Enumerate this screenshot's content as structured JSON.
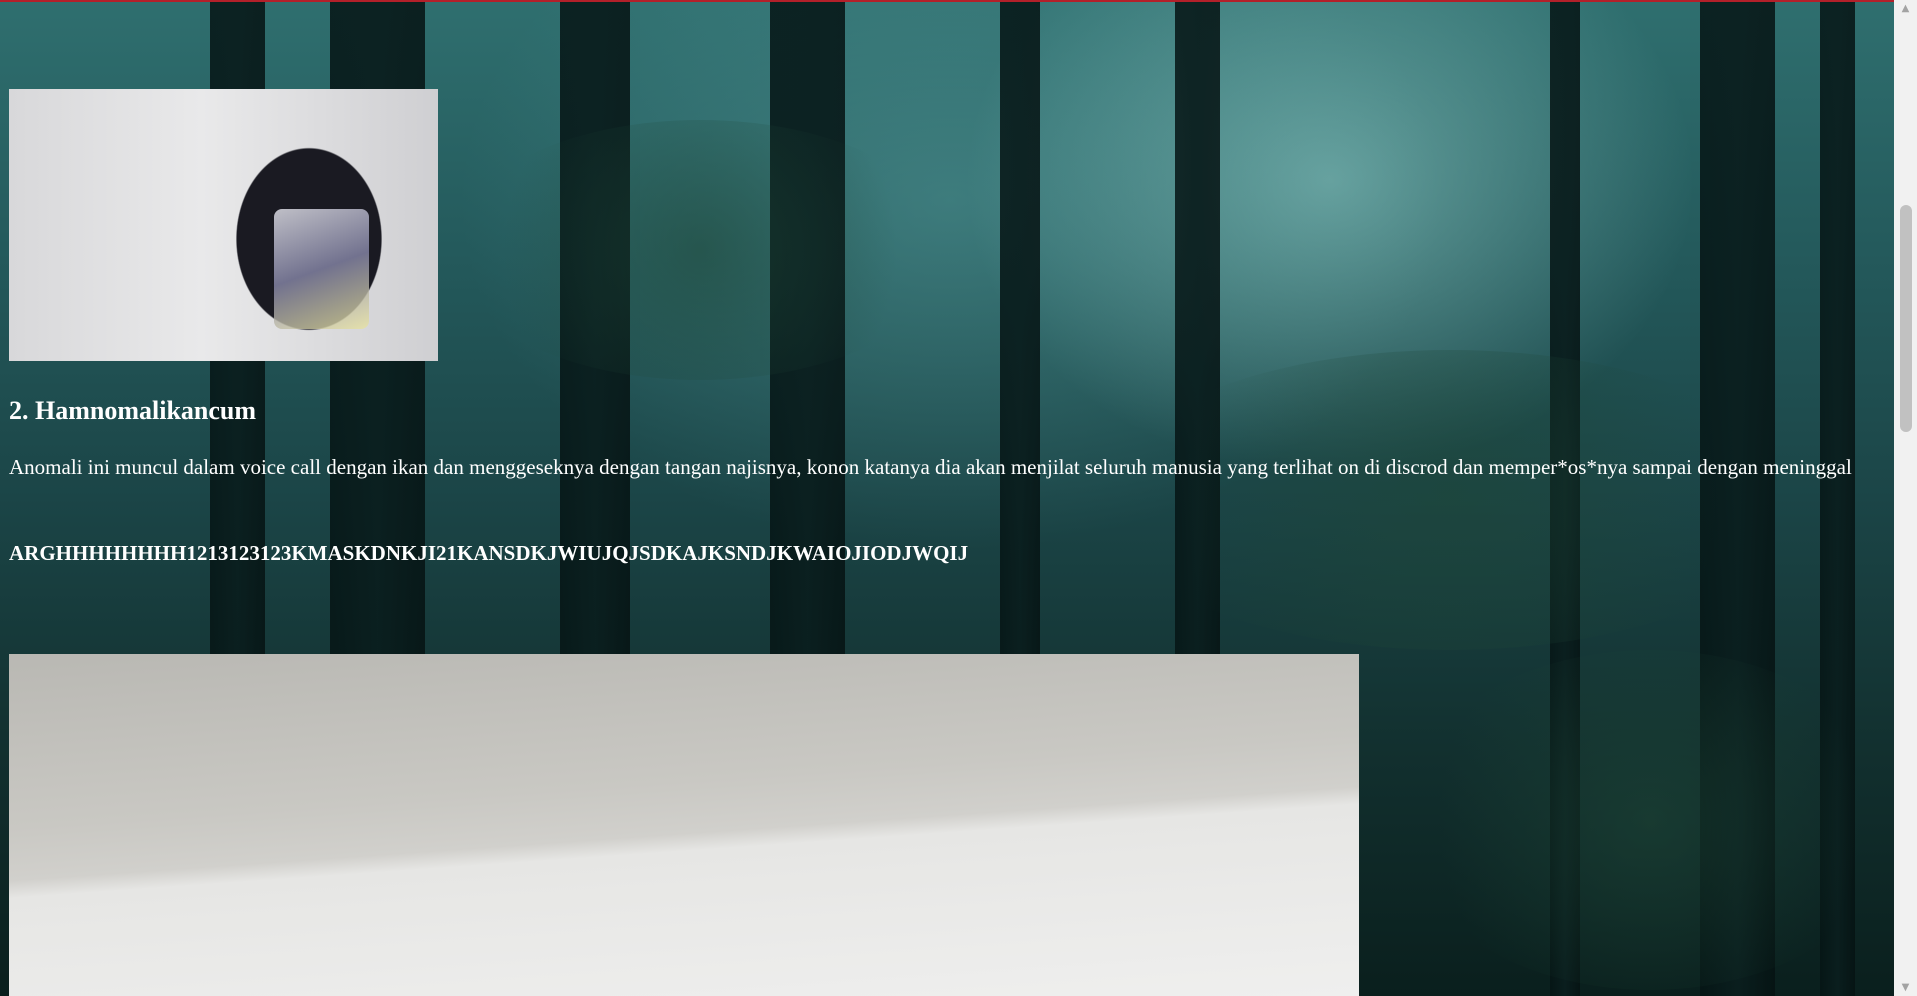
{
  "article": {
    "heading": "2. Hamnomalikancum",
    "description": "Anomali ini muncul dalam voice call dengan ikan dan menggeseknya dengan tangan najisnya, konon katanya dia akan menjilat seluruh manusia yang terlihat on di discrod dan memper*os*nya sampai dengan meninggal",
    "shout": "ARGHHHHHHHH1213123123KMASKDNKJI21KANSDKJWIUJQJSDKAJKSNDJKWAIOJIODJWQIJ"
  },
  "scrollbar": {
    "up_icon": "▲",
    "down_icon": "▼"
  },
  "colors": {
    "text": "#ffffff",
    "top_border": "#b3202a",
    "scrollbar_track": "#f1f1f1",
    "scrollbar_thumb": "#c1c1c1"
  }
}
